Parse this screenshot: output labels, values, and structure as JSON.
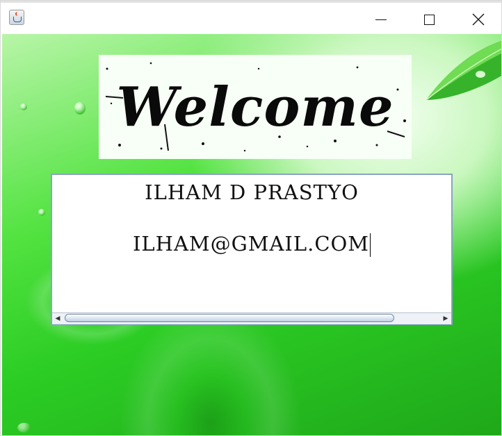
{
  "window": {
    "title": "",
    "icon": "java-cup-icon",
    "controls": {
      "minimize": "minimize-icon",
      "maximize": "maximize-icon",
      "close": "close-icon"
    }
  },
  "banner": {
    "text": "Welcome"
  },
  "text_area": {
    "name": "ILHAM D PRASTYO",
    "email": "ILHAM@GMAIL.COM"
  },
  "colors": {
    "background_green": "#2ccd24",
    "text_area_border": "#8aa2c8",
    "scroll_thumb_border": "#6f86a8"
  }
}
